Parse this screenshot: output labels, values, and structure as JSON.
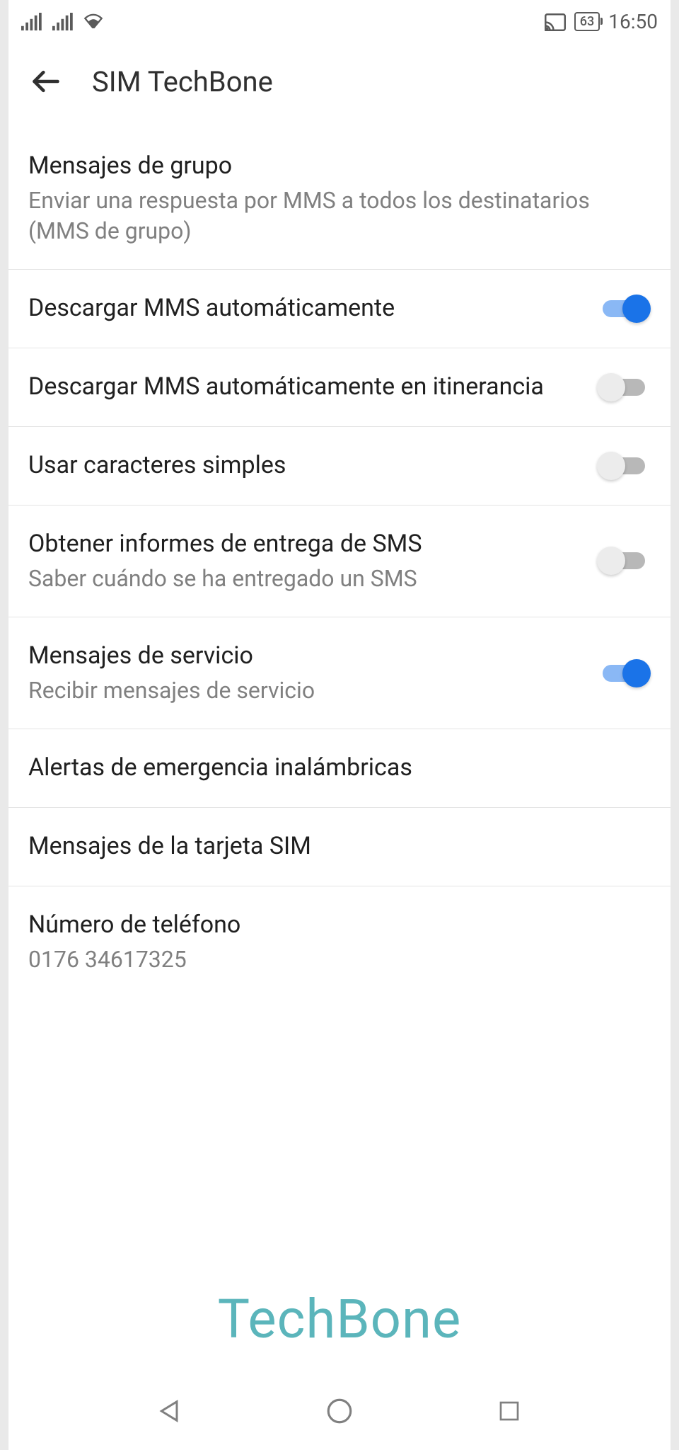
{
  "status_bar": {
    "battery_percent": "63",
    "time": "16:50"
  },
  "header": {
    "title": "SIM TechBone"
  },
  "settings": [
    {
      "title": "Mensajes de grupo",
      "subtitle": "Enviar una respuesta por MMS a todos los destinatarios (MMS de grupo)",
      "has_toggle": false
    },
    {
      "title": "Descargar MMS automáticamente",
      "subtitle": "",
      "has_toggle": true,
      "toggle_on": true
    },
    {
      "title": "Descargar MMS automáticamente en itinerancia",
      "subtitle": "",
      "has_toggle": true,
      "toggle_on": false
    },
    {
      "title": "Usar caracteres simples",
      "subtitle": "",
      "has_toggle": true,
      "toggle_on": false
    },
    {
      "title": "Obtener informes de entrega de SMS",
      "subtitle": "Saber cuándo se ha entregado un SMS",
      "has_toggle": true,
      "toggle_on": false
    },
    {
      "title": "Mensajes de servicio",
      "subtitle": "Recibir mensajes de servicio",
      "has_toggle": true,
      "toggle_on": true
    },
    {
      "title": "Alertas de emergencia inalámbricas",
      "subtitle": "",
      "has_toggle": false
    },
    {
      "title": "Mensajes de la tarjeta SIM",
      "subtitle": "",
      "has_toggle": false
    },
    {
      "title": "Número de teléfono",
      "subtitle": "0176 34617325",
      "has_toggle": false
    }
  ],
  "watermark": "TechBone"
}
